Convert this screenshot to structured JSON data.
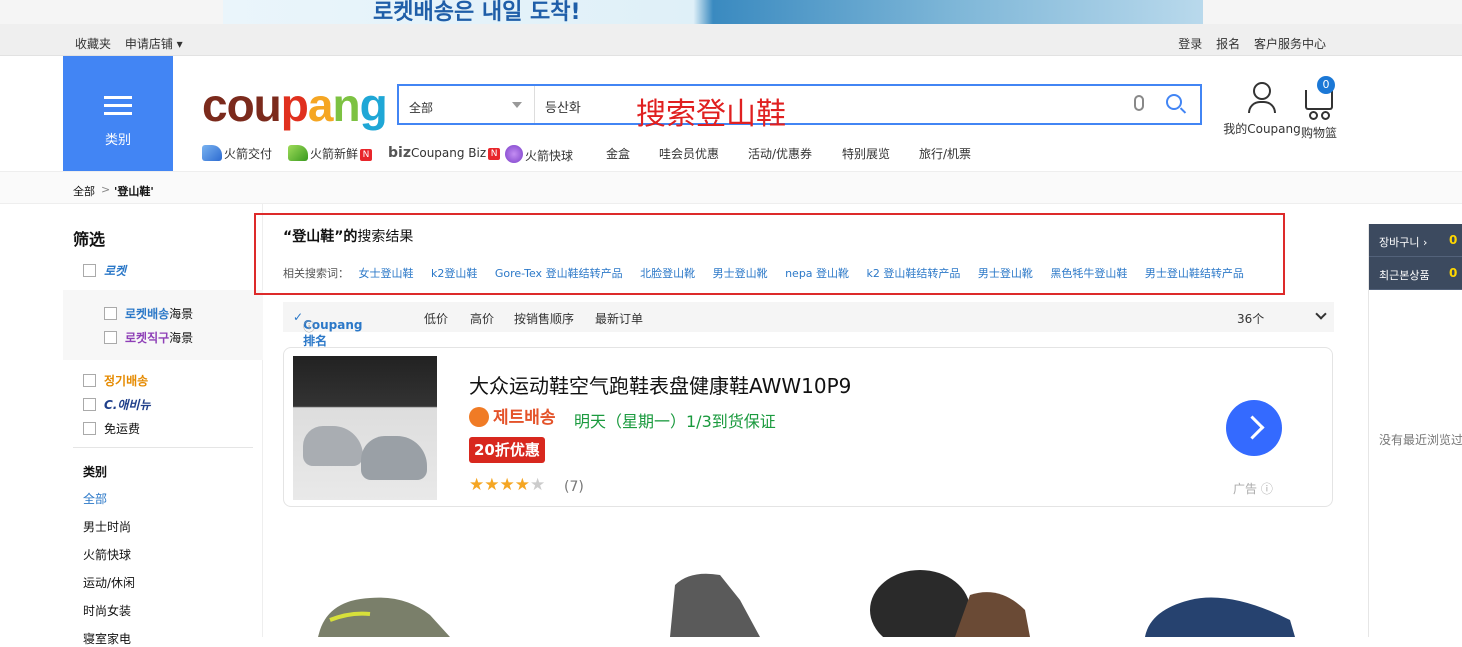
{
  "banner": {
    "text": "로켓배송은 내일 도착!"
  },
  "topbar": {
    "favorites": "收藏夹",
    "apply_store": "申请店铺",
    "login": "登录",
    "signup": "报名",
    "customer_service": "客户服务中心"
  },
  "header": {
    "category_label": "类别",
    "logo": {
      "part1": "cou",
      "part2": "p",
      "part3": "a",
      "part4": "n",
      "part5": "g"
    },
    "search_category": "全部",
    "search_value": "등산화",
    "annotation": "搜索登山鞋",
    "my_coupang": "我的Coupang",
    "cart_label": "购物篮",
    "cart_count": "0"
  },
  "nav": {
    "items": [
      "火箭交付",
      "火箭新鲜",
      "Coupang Biz",
      "火箭快球",
      "金盒",
      "哇会员优惠",
      "活动/优惠券",
      "特别展览",
      "旅行/机票"
    ],
    "biz_prefix": "biz",
    "new_badge": "N"
  },
  "breadcrumb": {
    "root": "全部",
    "sep": ">",
    "current": "'登山鞋'"
  },
  "sidebar": {
    "title": "筛选",
    "rocket": "로켓",
    "rocket_overseas_a": "로켓배송",
    "rocket_overseas_a_suffix": "海景",
    "rocket_overseas_b": "로켓직구",
    "rocket_overseas_b_suffix": "海景",
    "subscription": "정기배송",
    "c_avenue": "C.애비뉴",
    "free_shipping": "免运费",
    "category_title": "类别",
    "categories": [
      "全部",
      "男士时尚",
      "火箭快球",
      "运动/休闲",
      "时尚女装",
      "寝室家电"
    ]
  },
  "results": {
    "query_quoted": "“登山鞋”的",
    "suffix": "搜索结果",
    "related_label": "相关搜索词：",
    "related": [
      "女士登山鞋",
      "k2登山鞋",
      "Gore-Tex 登山鞋结转产品",
      "北脸登山靴",
      "男士登山靴",
      "nepa 登山靴",
      "k2 登山鞋结转产品",
      "男士登山靴",
      "黑色牦牛登山鞋",
      "男士登山鞋结转产品"
    ]
  },
  "sort": {
    "coupang_rank": "Coupang 排名",
    "low_price": "低价",
    "high_price": "高价",
    "sales": "按销售顺序",
    "newest": "最新订单",
    "count": "36个"
  },
  "ad": {
    "title": "大众运动鞋空气跑鞋表盘健康鞋AWW10P9",
    "jet_label": "제트배송",
    "delivery": "明天（星期一）1/3到货保证",
    "coupon": "20折优惠",
    "rating": 4,
    "rating_count": "(7)",
    "ad_label": "广告"
  },
  "right_panel": {
    "basket": "장바구니 ›",
    "basket_count": "0",
    "recent": "최근본상품",
    "recent_count": "0",
    "empty": "没有最近浏览过"
  },
  "colors": {
    "accent": "#4285f4",
    "link": "#2b78c8",
    "coupon": "#d8281e",
    "delivery": "#1a9a3e",
    "highlight_box": "#dd2a2a"
  }
}
